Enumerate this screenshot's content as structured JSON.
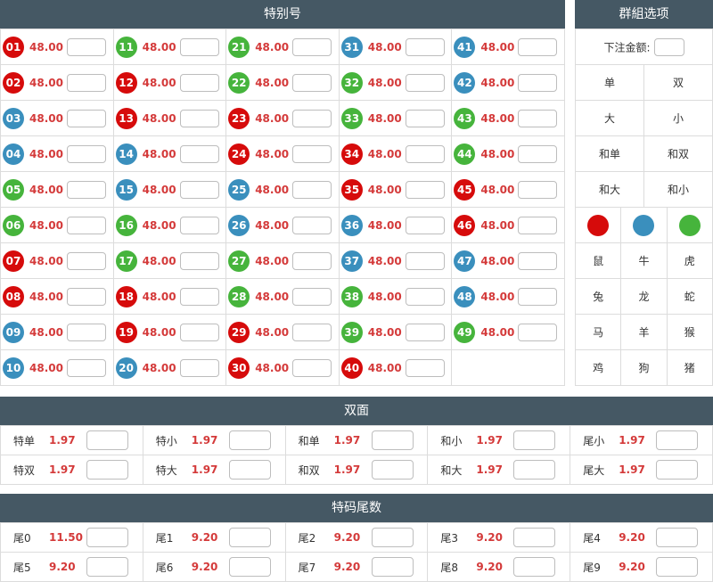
{
  "special": {
    "title": "特别号",
    "cells": [
      {
        "num": "01",
        "odds": "48.00",
        "color": "red"
      },
      {
        "num": "11",
        "odds": "48.00",
        "color": "green"
      },
      {
        "num": "21",
        "odds": "48.00",
        "color": "green"
      },
      {
        "num": "31",
        "odds": "48.00",
        "color": "blue"
      },
      {
        "num": "41",
        "odds": "48.00",
        "color": "blue"
      },
      {
        "num": "02",
        "odds": "48.00",
        "color": "red"
      },
      {
        "num": "12",
        "odds": "48.00",
        "color": "red"
      },
      {
        "num": "22",
        "odds": "48.00",
        "color": "green"
      },
      {
        "num": "32",
        "odds": "48.00",
        "color": "green"
      },
      {
        "num": "42",
        "odds": "48.00",
        "color": "blue"
      },
      {
        "num": "03",
        "odds": "48.00",
        "color": "blue"
      },
      {
        "num": "13",
        "odds": "48.00",
        "color": "red"
      },
      {
        "num": "23",
        "odds": "48.00",
        "color": "red"
      },
      {
        "num": "33",
        "odds": "48.00",
        "color": "green"
      },
      {
        "num": "43",
        "odds": "48.00",
        "color": "green"
      },
      {
        "num": "04",
        "odds": "48.00",
        "color": "blue"
      },
      {
        "num": "14",
        "odds": "48.00",
        "color": "blue"
      },
      {
        "num": "24",
        "odds": "48.00",
        "color": "red"
      },
      {
        "num": "34",
        "odds": "48.00",
        "color": "red"
      },
      {
        "num": "44",
        "odds": "48.00",
        "color": "green"
      },
      {
        "num": "05",
        "odds": "48.00",
        "color": "green"
      },
      {
        "num": "15",
        "odds": "48.00",
        "color": "blue"
      },
      {
        "num": "25",
        "odds": "48.00",
        "color": "blue"
      },
      {
        "num": "35",
        "odds": "48.00",
        "color": "red"
      },
      {
        "num": "45",
        "odds": "48.00",
        "color": "red"
      },
      {
        "num": "06",
        "odds": "48.00",
        "color": "green"
      },
      {
        "num": "16",
        "odds": "48.00",
        "color": "green"
      },
      {
        "num": "26",
        "odds": "48.00",
        "color": "blue"
      },
      {
        "num": "36",
        "odds": "48.00",
        "color": "blue"
      },
      {
        "num": "46",
        "odds": "48.00",
        "color": "red"
      },
      {
        "num": "07",
        "odds": "48.00",
        "color": "red"
      },
      {
        "num": "17",
        "odds": "48.00",
        "color": "green"
      },
      {
        "num": "27",
        "odds": "48.00",
        "color": "green"
      },
      {
        "num": "37",
        "odds": "48.00",
        "color": "blue"
      },
      {
        "num": "47",
        "odds": "48.00",
        "color": "blue"
      },
      {
        "num": "08",
        "odds": "48.00",
        "color": "red"
      },
      {
        "num": "18",
        "odds": "48.00",
        "color": "red"
      },
      {
        "num": "28",
        "odds": "48.00",
        "color": "green"
      },
      {
        "num": "38",
        "odds": "48.00",
        "color": "green"
      },
      {
        "num": "48",
        "odds": "48.00",
        "color": "blue"
      },
      {
        "num": "09",
        "odds": "48.00",
        "color": "blue"
      },
      {
        "num": "19",
        "odds": "48.00",
        "color": "red"
      },
      {
        "num": "29",
        "odds": "48.00",
        "color": "red"
      },
      {
        "num": "39",
        "odds": "48.00",
        "color": "green"
      },
      {
        "num": "49",
        "odds": "48.00",
        "color": "green"
      },
      {
        "num": "10",
        "odds": "48.00",
        "color": "blue"
      },
      {
        "num": "20",
        "odds": "48.00",
        "color": "blue"
      },
      {
        "num": "30",
        "odds": "48.00",
        "color": "red"
      },
      {
        "num": "40",
        "odds": "48.00",
        "color": "red"
      }
    ]
  },
  "group": {
    "title": "群組选项",
    "amount_label": "下注金额:",
    "pairs": [
      [
        "单",
        "双"
      ],
      [
        "大",
        "小"
      ],
      [
        "和单",
        "和双"
      ],
      [
        "和大",
        "和小"
      ]
    ],
    "color_balls": [
      "red",
      "blue",
      "green"
    ],
    "zodiac": [
      [
        "鼠",
        "牛",
        "虎"
      ],
      [
        "兔",
        "龙",
        "蛇"
      ],
      [
        "马",
        "羊",
        "猴"
      ],
      [
        "鸡",
        "狗",
        "猪"
      ]
    ]
  },
  "twoside": {
    "title": "双面",
    "rows": [
      [
        {
          "label": "特单",
          "odds": "1.97"
        },
        {
          "label": "特小",
          "odds": "1.97"
        },
        {
          "label": "和单",
          "odds": "1.97"
        },
        {
          "label": "和小",
          "odds": "1.97"
        },
        {
          "label": "尾小",
          "odds": "1.97"
        }
      ],
      [
        {
          "label": "特双",
          "odds": "1.97"
        },
        {
          "label": "特大",
          "odds": "1.97"
        },
        {
          "label": "和双",
          "odds": "1.97"
        },
        {
          "label": "和大",
          "odds": "1.97"
        },
        {
          "label": "尾大",
          "odds": "1.97"
        }
      ]
    ]
  },
  "tail": {
    "title": "特码尾数",
    "rows": [
      [
        {
          "label": "尾0",
          "odds": "11.50"
        },
        {
          "label": "尾1",
          "odds": "9.20"
        },
        {
          "label": "尾2",
          "odds": "9.20"
        },
        {
          "label": "尾3",
          "odds": "9.20"
        },
        {
          "label": "尾4",
          "odds": "9.20"
        }
      ],
      [
        {
          "label": "尾5",
          "odds": "9.20"
        },
        {
          "label": "尾6",
          "odds": "9.20"
        },
        {
          "label": "尾7",
          "odds": "9.20"
        },
        {
          "label": "尾8",
          "odds": "9.20"
        },
        {
          "label": "尾9",
          "odds": "9.20"
        }
      ]
    ]
  },
  "colors": {
    "red": "#d60b0b",
    "blue": "#3a8fbd",
    "green": "#46b43c",
    "odds": "#d43a3a",
    "header": "#455864"
  }
}
